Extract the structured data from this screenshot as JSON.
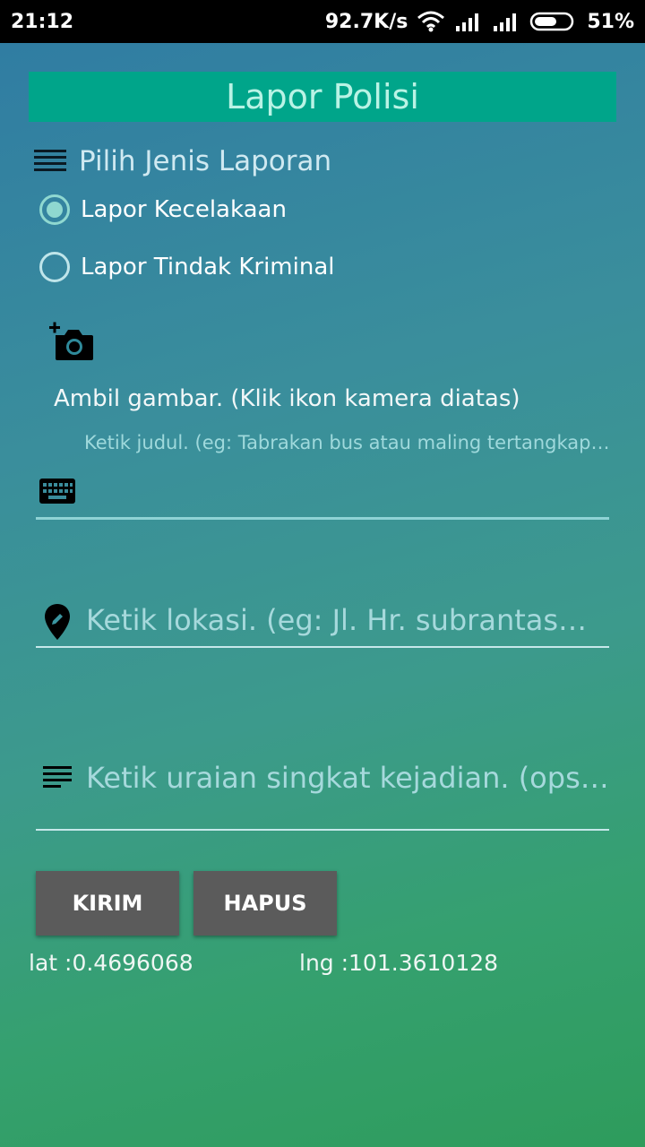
{
  "status_bar": {
    "time": "21:12",
    "net_speed": "92.7K/s",
    "battery": "51%"
  },
  "header": {
    "title": "Lapor Polisi"
  },
  "report_type": {
    "label": "Pilih Jenis Laporan",
    "options": [
      {
        "label": "Lapor Kecelakaan",
        "selected": true
      },
      {
        "label": "Lapor Tindak Kriminal",
        "selected": false
      }
    ]
  },
  "camera": {
    "hint": "Ambil gambar. (Klik ikon kamera diatas)"
  },
  "title_field": {
    "placeholder": "Ketik judul. (eg: Tabrakan bus atau maling tertangkap…",
    "value": ""
  },
  "location_field": {
    "placeholder": "Ketik lokasi. (eg: Jl. Hr. subrantas…",
    "value": ""
  },
  "description_field": {
    "placeholder": "Ketik uraian singkat kejadian. (ops…",
    "value": ""
  },
  "buttons": {
    "send": "KIRIM",
    "clear": "HAPUS"
  },
  "coordinates": {
    "lat": "lat :0.4696068",
    "lng": "lng :101.3610128"
  },
  "colors": {
    "header_bg": "#00a58a",
    "button_bg": "#5b5b5b",
    "accent": "#8fd8d0"
  },
  "icons": [
    "wifi-icon",
    "signal-icon",
    "battery-icon",
    "list-icon",
    "add-camera-icon",
    "keyboard-icon",
    "location-edit-icon",
    "text-lines-icon"
  ]
}
